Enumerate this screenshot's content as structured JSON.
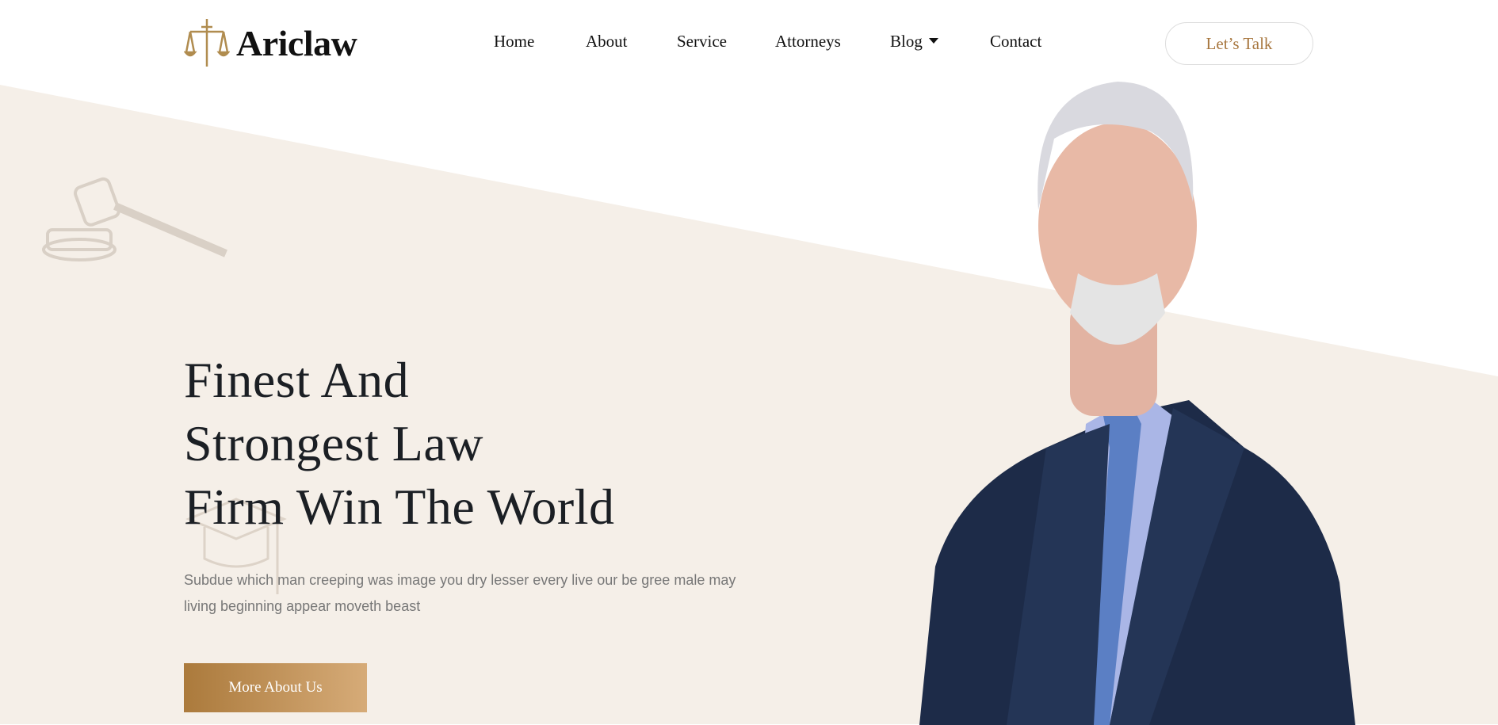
{
  "brand": {
    "name": "Ariclaw",
    "logo_icon": "scales-of-justice-icon",
    "accent": "#a8773f"
  },
  "nav": {
    "items": [
      {
        "label": "Home"
      },
      {
        "label": "About"
      },
      {
        "label": "Service"
      },
      {
        "label": "Attorneys"
      },
      {
        "label": "Blog",
        "has_dropdown": true
      },
      {
        "label": "Contact"
      }
    ],
    "cta_label": "Let’s Talk"
  },
  "hero": {
    "title_lines": [
      "Finest And",
      "Strongest Law",
      "Firm Win The World"
    ],
    "description": "Subdue which man creeping was image you dry lesser every live our be gree male may living beginning appear moveth beast",
    "button_label": "More About Us",
    "background": "#f5efe8"
  }
}
